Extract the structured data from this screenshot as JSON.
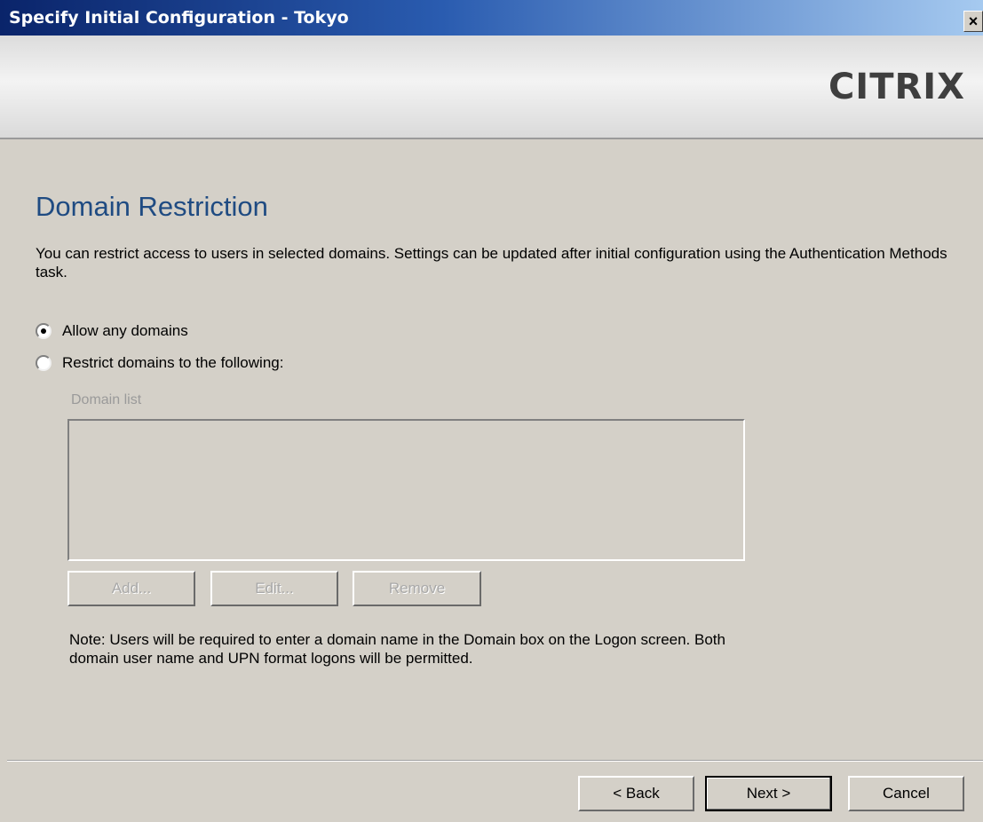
{
  "window": {
    "title": "Specify Initial Configuration - Tokyo",
    "close_glyph": "×"
  },
  "banner": {
    "logo_text": "CITRIX"
  },
  "page": {
    "heading": "Domain Restriction",
    "description": "You can restrict access to users in selected domains. Settings can be updated after initial configuration using the Authentication Methods task."
  },
  "options": {
    "allow_any_label": "Allow any domains",
    "allow_any_selected": true,
    "restrict_label": "Restrict domains to the following:",
    "restrict_selected": false
  },
  "domain_list": {
    "label": "Domain list",
    "items": []
  },
  "list_buttons": {
    "add": "Add...",
    "edit": "Edit...",
    "remove": "Remove"
  },
  "note": "Note: Users will be required to enter a domain name in the Domain box on the Logon screen. Both domain user name and UPN format logons will be permitted.",
  "footer": {
    "back": "< Back",
    "next": "Next >",
    "cancel": "Cancel"
  },
  "colors": {
    "heading": "#1f4b82",
    "titlebar_start": "#0a246a",
    "dialog_bg": "#d4d0c8"
  }
}
